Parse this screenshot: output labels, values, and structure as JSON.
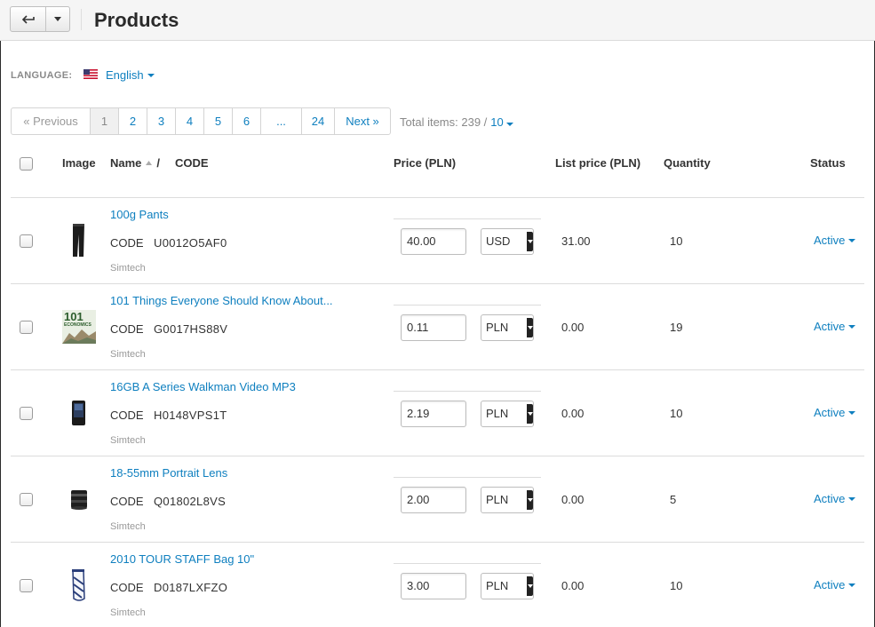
{
  "header": {
    "title": "Products"
  },
  "language": {
    "label": "LANGUAGE:",
    "value": "English"
  },
  "pagination": {
    "previous": "« Previous",
    "pages": [
      "1",
      "2",
      "3",
      "4",
      "5",
      "6",
      "...",
      "24"
    ],
    "active_page": "1",
    "next": "Next »",
    "total_label": "Total items: 239 /",
    "per_page": "10"
  },
  "table": {
    "columns": {
      "image": "Image",
      "name": "Name",
      "sort_sep": "/",
      "code": "CODE",
      "price": "Price (PLN)",
      "list_price": "List price (PLN)",
      "quantity": "Quantity",
      "status": "Status"
    },
    "rows": [
      {
        "name": "100g Pants",
        "code_label": "CODE",
        "code": "U0012O5AF0",
        "vendor": "Simtech",
        "price": "40.00",
        "currency": "USD",
        "list_price": "31.00",
        "quantity": "10",
        "status": "Active"
      },
      {
        "name": "101 Things Everyone Should Know About...",
        "code_label": "CODE",
        "code": "G0017HS88V",
        "vendor": "Simtech",
        "price": "0.11",
        "currency": "PLN",
        "list_price": "0.00",
        "quantity": "19",
        "status": "Active"
      },
      {
        "name": "16GB A Series Walkman Video MP3",
        "code_label": "CODE",
        "code": "H0148VPS1T",
        "vendor": "Simtech",
        "price": "2.19",
        "currency": "PLN",
        "list_price": "0.00",
        "quantity": "10",
        "status": "Active"
      },
      {
        "name": "18-55mm Portrait Lens",
        "code_label": "CODE",
        "code": "Q01802L8VS",
        "vendor": "Simtech",
        "price": "2.00",
        "currency": "PLN",
        "list_price": "0.00",
        "quantity": "5",
        "status": "Active"
      },
      {
        "name": "2010 TOUR STAFF Bag 10\"",
        "code_label": "CODE",
        "code": "D0187LXFZO",
        "vendor": "Simtech",
        "price": "3.00",
        "currency": "PLN",
        "list_price": "0.00",
        "quantity": "10",
        "status": "Active"
      }
    ]
  },
  "thumb_text": {
    "book_title": "101",
    "book_sub": "ECONOMICS"
  },
  "icons": {
    "back": "back-arrow-icon",
    "dropdown": "chevron-down-icon",
    "flag": "us-flag-icon",
    "sort": "sort-asc-icon"
  },
  "colors": {
    "link": "#0e7fbf",
    "muted": "#888888",
    "border": "#dcdcdc"
  }
}
